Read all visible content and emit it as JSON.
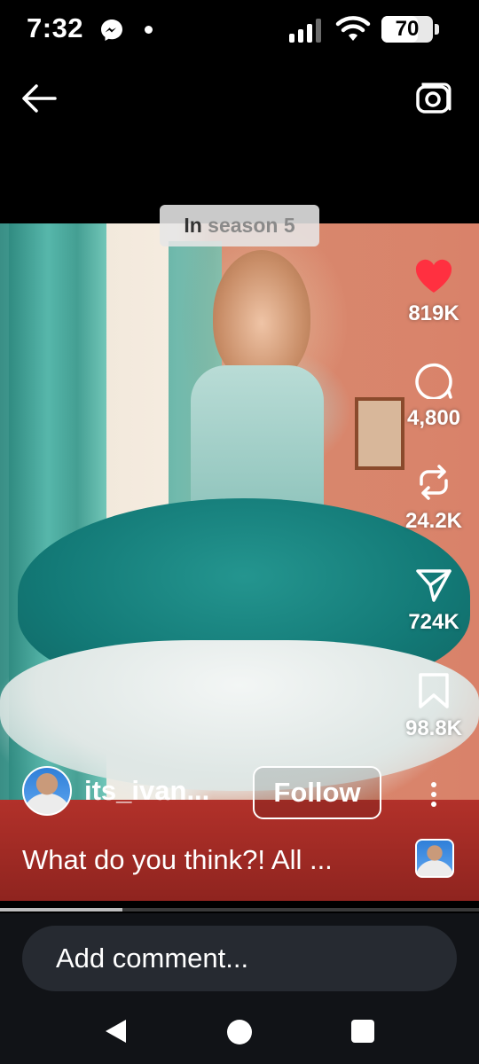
{
  "status_bar": {
    "time": "7:32",
    "battery": "70",
    "battery_level": 0.7,
    "icons": [
      "messenger-icon",
      "dot-icon",
      "signal-icon",
      "wifi-icon",
      "battery-icon"
    ]
  },
  "header": {
    "icons": [
      "back-arrow-icon",
      "camera-icon"
    ]
  },
  "video": {
    "badge_prefix": "In",
    "badge_rest": " season 5"
  },
  "actions": {
    "like": {
      "count": "819K",
      "icon": "heart-icon",
      "color": "#ff3040"
    },
    "comment": {
      "count": "4,800",
      "icon": "comment-icon"
    },
    "repost": {
      "count": "24.2K",
      "icon": "repost-icon"
    },
    "share": {
      "count": "724K",
      "icon": "send-icon"
    },
    "save": {
      "count": "98.8K",
      "icon": "bookmark-icon"
    }
  },
  "post": {
    "username": "its_ivan...",
    "follow_label": "Follow",
    "caption": "What do you think?! All ..."
  },
  "playback": {
    "progress": 0.255
  },
  "comment_box": {
    "placeholder": "Add comment..."
  },
  "nav_bar": {
    "icons": [
      "nav-back-icon",
      "nav-home-icon",
      "nav-recents-icon"
    ]
  }
}
